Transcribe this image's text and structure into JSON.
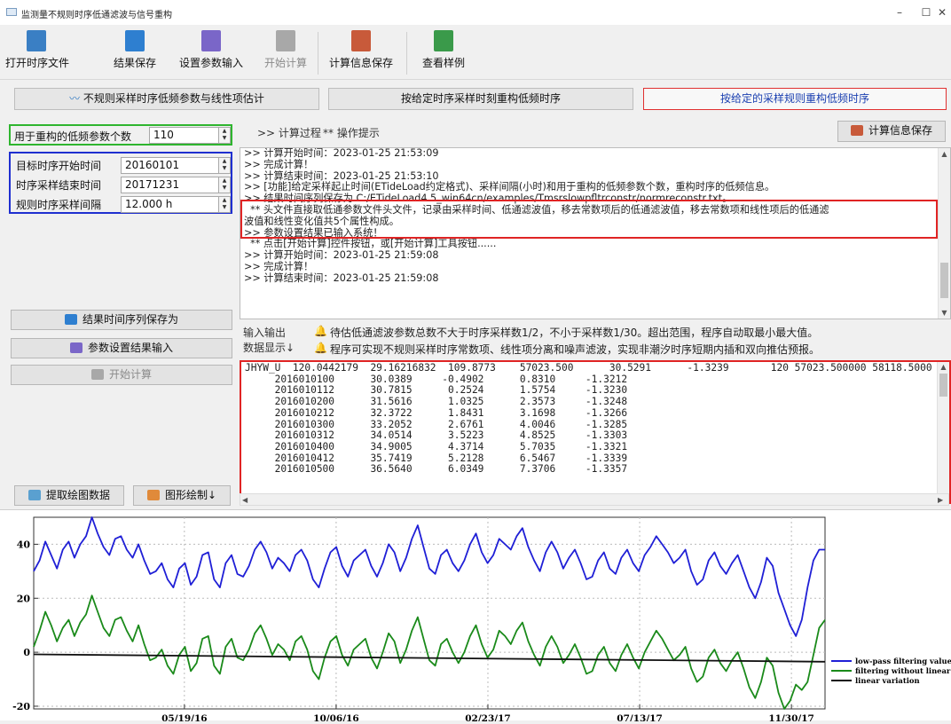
{
  "window": {
    "title": "监测量不规则时序低通滤波与信号重构",
    "minimize": "–",
    "maximize": "☐",
    "close": "✕"
  },
  "toolbar": [
    {
      "label": "打开时序文件",
      "icon": "open-file-icon",
      "color": "#3a7fc4",
      "disabled": false
    },
    {
      "label": "结果保存",
      "icon": "save-icon",
      "color": "#2e7fd0",
      "disabled": false
    },
    {
      "label": "设置参数输入",
      "icon": "settings-input-icon",
      "color": "#7a66c8",
      "disabled": false
    },
    {
      "label": "开始计算",
      "icon": "calculate-icon",
      "color": "#a8a8a8",
      "disabled": true
    },
    {
      "label": "计算信息保存",
      "icon": "info-save-icon",
      "color": "#c85a3a",
      "disabled": false
    },
    {
      "label": "查看样例",
      "icon": "examples-icon",
      "color": "#3a9a4a",
      "disabled": false
    }
  ],
  "tabs": [
    {
      "label": "不规则采样时序低频参数与线性项估计",
      "active": false
    },
    {
      "label": "按给定时序采样时刻重构低频时序",
      "active": false
    },
    {
      "label": "按给定的采样规则重构低频时序",
      "active": true
    }
  ],
  "params": {
    "lowfreq_count_label": "用于重构的低频参数个数",
    "lowfreq_count_value": "110",
    "start_label": "目标时序开始时间",
    "start_value": "20160101",
    "end_label": "时序采样结束时间",
    "end_value": "20171231",
    "interval_label": "规则时序采样间隔",
    "interval_value": "12.000 h"
  },
  "side_buttons": {
    "save_series": "结果时间序列保存为",
    "param_input": "参数设置结果输入",
    "start_calc": "开始计算",
    "extract_plot": "提取绘图数据",
    "draw_plot": "图形绘制↓"
  },
  "log_header": {
    "process": ">> 计算过程",
    "hint": "** 操作提示",
    "save_button": "计算信息保存"
  },
  "log_lines": [
    ">> 计算开始时间：2023-01-25 21:53:09",
    ">> 完成计算！",
    ">> 计算结束时间：2023-01-25 21:53:10",
    ">> [功能]给定采样起止时间(ETideLoad约定格式)、采样间隔(小时)和用于重构的低频参数个数，重构时序的低频信息。",
    ">> 结果时间序列保存为 C:/ETideLoad4.5_win64cn/examples/Tmsrslowpfltrconstr/normreconstr.txt。",
    "  ** 头文件直接取低通参数文件头文件，记录由采样时间、低通滤波值，移去常数项后的低通滤波值，移去常数项和线性项后的低通滤",
    "波值和线性变化值共5个属性构成。",
    ">> 参数设置结果已输入系统！",
    "  ** 点击[开始计算]控件按钮，或[开始计算]工具按钮......",
    ">> 计算开始时间：2023-01-25 21:59:08",
    ">> 完成计算！",
    ">> 计算结束时间：2023-01-25 21:59:08"
  ],
  "notice": {
    "label1": "输入输出",
    "label2": "数据显示↓",
    "line1": "待估低通滤波参数总数不大于时序采样数1/2，不小于采样数1/30。超出范围，程序自动取最小最大值。",
    "line2": "程序可实现不规则采样时序常数项、线性项分离和噪声滤波，实现非潮汐时序短期内插和双向推估预报。"
  },
  "data_rows": [
    "JHYW_U  120.0442179  29.16216832  109.8773    57023.500      30.5291      -1.3239       120 57023.500000 58118.5000",
    "     2016010100      30.0389     -0.4902      0.8310     -1.3212",
    "     2016010112      30.7815      0.2524      1.5754     -1.3230",
    "     2016010200      31.5616      1.0325      2.3573     -1.3248",
    "     2016010212      32.3722      1.8431      3.1698     -1.3266",
    "     2016010300      33.2052      2.6761      4.0046     -1.3285",
    "     2016010312      34.0514      3.5223      4.8525     -1.3303",
    "     2016010400      34.9005      4.3714      5.7035     -1.3321",
    "     2016010412      35.7419      5.2128      6.5467     -1.3339",
    "     2016010500      36.5640      6.0349      7.3706     -1.3357"
  ],
  "chart_data": {
    "type": "line",
    "x_ticks": [
      "05/19/16",
      "10/06/16",
      "02/23/17",
      "07/13/17",
      "11/30/17"
    ],
    "x_range": [
      "2016-01-01",
      "2017-12-31"
    ],
    "y_ticks": [
      "-20",
      "0",
      "20",
      "40"
    ],
    "ylim": [
      -21,
      50
    ],
    "legend_position": "bottom-right",
    "series": [
      {
        "name": "low-pass filtering value",
        "color": "#1f1fd6",
        "values": [
          30,
          34,
          41,
          36,
          31,
          38,
          41,
          35,
          40,
          43,
          50,
          44,
          39,
          36,
          42,
          43,
          38,
          35,
          40,
          34,
          29,
          30,
          33,
          27,
          24,
          31,
          33,
          25,
          28,
          36,
          37,
          27,
          24,
          33,
          36,
          29,
          28,
          32,
          38,
          41,
          37,
          31,
          35,
          33,
          30,
          36,
          38,
          34,
          27,
          24,
          31,
          37,
          39,
          32,
          28,
          34,
          36,
          38,
          32,
          28,
          33,
          40,
          37,
          30,
          35,
          42,
          47,
          39,
          31,
          29,
          36,
          38,
          33,
          30,
          34,
          40,
          44,
          37,
          33,
          36,
          42,
          40,
          38,
          43,
          46,
          39,
          34,
          30,
          37,
          41,
          37,
          31,
          35,
          38,
          33,
          27,
          28,
          34,
          37,
          31,
          29,
          35,
          38,
          33,
          30,
          36,
          39,
          43,
          40,
          37,
          33,
          35,
          38,
          30,
          25,
          27,
          34,
          37,
          32,
          29,
          33,
          36,
          30,
          24,
          20,
          26,
          35,
          32,
          22,
          16,
          10,
          6,
          12,
          24,
          34,
          38,
          38
        ]
      },
      {
        "name": "filtering without linear",
        "color": "#1a8a1a",
        "values": [
          2,
          8,
          15,
          10,
          4,
          9,
          12,
          6,
          11,
          14,
          21,
          15,
          9,
          6,
          12,
          13,
          8,
          4,
          10,
          3,
          -3,
          -2,
          1,
          -5,
          -8,
          -1,
          2,
          -7,
          -4,
          5,
          6,
          -5,
          -8,
          2,
          5,
          -2,
          -3,
          1,
          7,
          10,
          5,
          -1,
          3,
          1,
          -3,
          4,
          6,
          1,
          -7,
          -10,
          -2,
          4,
          6,
          -1,
          -5,
          1,
          3,
          5,
          -2,
          -6,
          0,
          7,
          4,
          -4,
          1,
          8,
          13,
          5,
          -3,
          -5,
          3,
          5,
          0,
          -4,
          0,
          6,
          10,
          3,
          -2,
          1,
          8,
          6,
          3,
          8,
          11,
          4,
          -1,
          -5,
          2,
          6,
          2,
          -4,
          -1,
          3,
          -2,
          -8,
          -7,
          -1,
          2,
          -4,
          -7,
          -1,
          3,
          -2,
          -6,
          0,
          4,
          8,
          5,
          1,
          -3,
          -1,
          2,
          -6,
          -11,
          -9,
          -2,
          1,
          -4,
          -7,
          -3,
          0,
          -6,
          -13,
          -17,
          -11,
          -2,
          -5,
          -15,
          -21,
          -18,
          -12,
          -14,
          -11,
          -1,
          9,
          12
        ]
      },
      {
        "name": "linear variation",
        "color": "#111111",
        "values": [
          -0.8,
          -3.5
        ]
      }
    ]
  }
}
